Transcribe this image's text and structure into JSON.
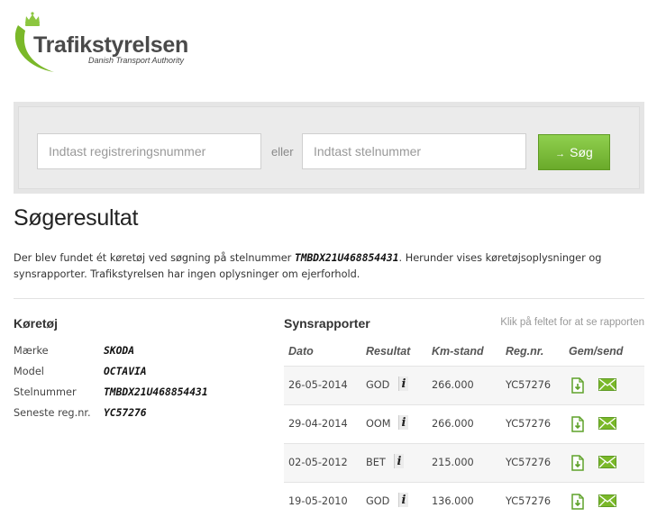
{
  "header": {
    "brand_name": "Trafikstyrelsen",
    "brand_subtitle": "Danish Transport Authority"
  },
  "search": {
    "reg_placeholder": "Indtast registreringsnummer",
    "or_label": "eller",
    "stel_placeholder": "Indtast stelnummer",
    "search_arrow": "→",
    "search_label": "Søg"
  },
  "result": {
    "title": "Søgeresultat",
    "text_before": "Der blev fundet ét køretøj ved søgning på stelnummer ",
    "vin": "TMBDX21U468854431",
    "text_after": ". Herunder vises køretøjsoplysninger og synsrapporter. Trafikstyrelsen har ingen oplysninger om ejerforhold."
  },
  "vehicle": {
    "title": "Køretøj",
    "fields": [
      {
        "label": "Mærke",
        "value": "SKODA"
      },
      {
        "label": "Model",
        "value": "OCTAVIA"
      },
      {
        "label": "Stelnummer",
        "value": "TMBDX21U468854431"
      },
      {
        "label": "Seneste reg.nr.",
        "value": "YC57276"
      }
    ]
  },
  "reports": {
    "title": "Synsrapporter",
    "hint": "Klik på feltet for at se rapporten",
    "columns": [
      "Dato",
      "Resultat",
      "Km-stand",
      "Reg.nr.",
      "Gem/send"
    ],
    "info_glyph": "i",
    "rows": [
      {
        "date": "26-05-2014",
        "result": "GOD",
        "km": "266.000",
        "reg": "YC57276"
      },
      {
        "date": "29-04-2014",
        "result": "OOM",
        "km": "266.000",
        "reg": "YC57276"
      },
      {
        "date": "02-05-2012",
        "result": "BET",
        "km": "215.000",
        "reg": "YC57276"
      },
      {
        "date": "19-05-2010",
        "result": "GOD",
        "km": "136.000",
        "reg": "YC57276"
      }
    ]
  },
  "colors": {
    "brand_green": "#7ab829",
    "button_green": "#76b934",
    "crown_green": "#8cc63f"
  }
}
